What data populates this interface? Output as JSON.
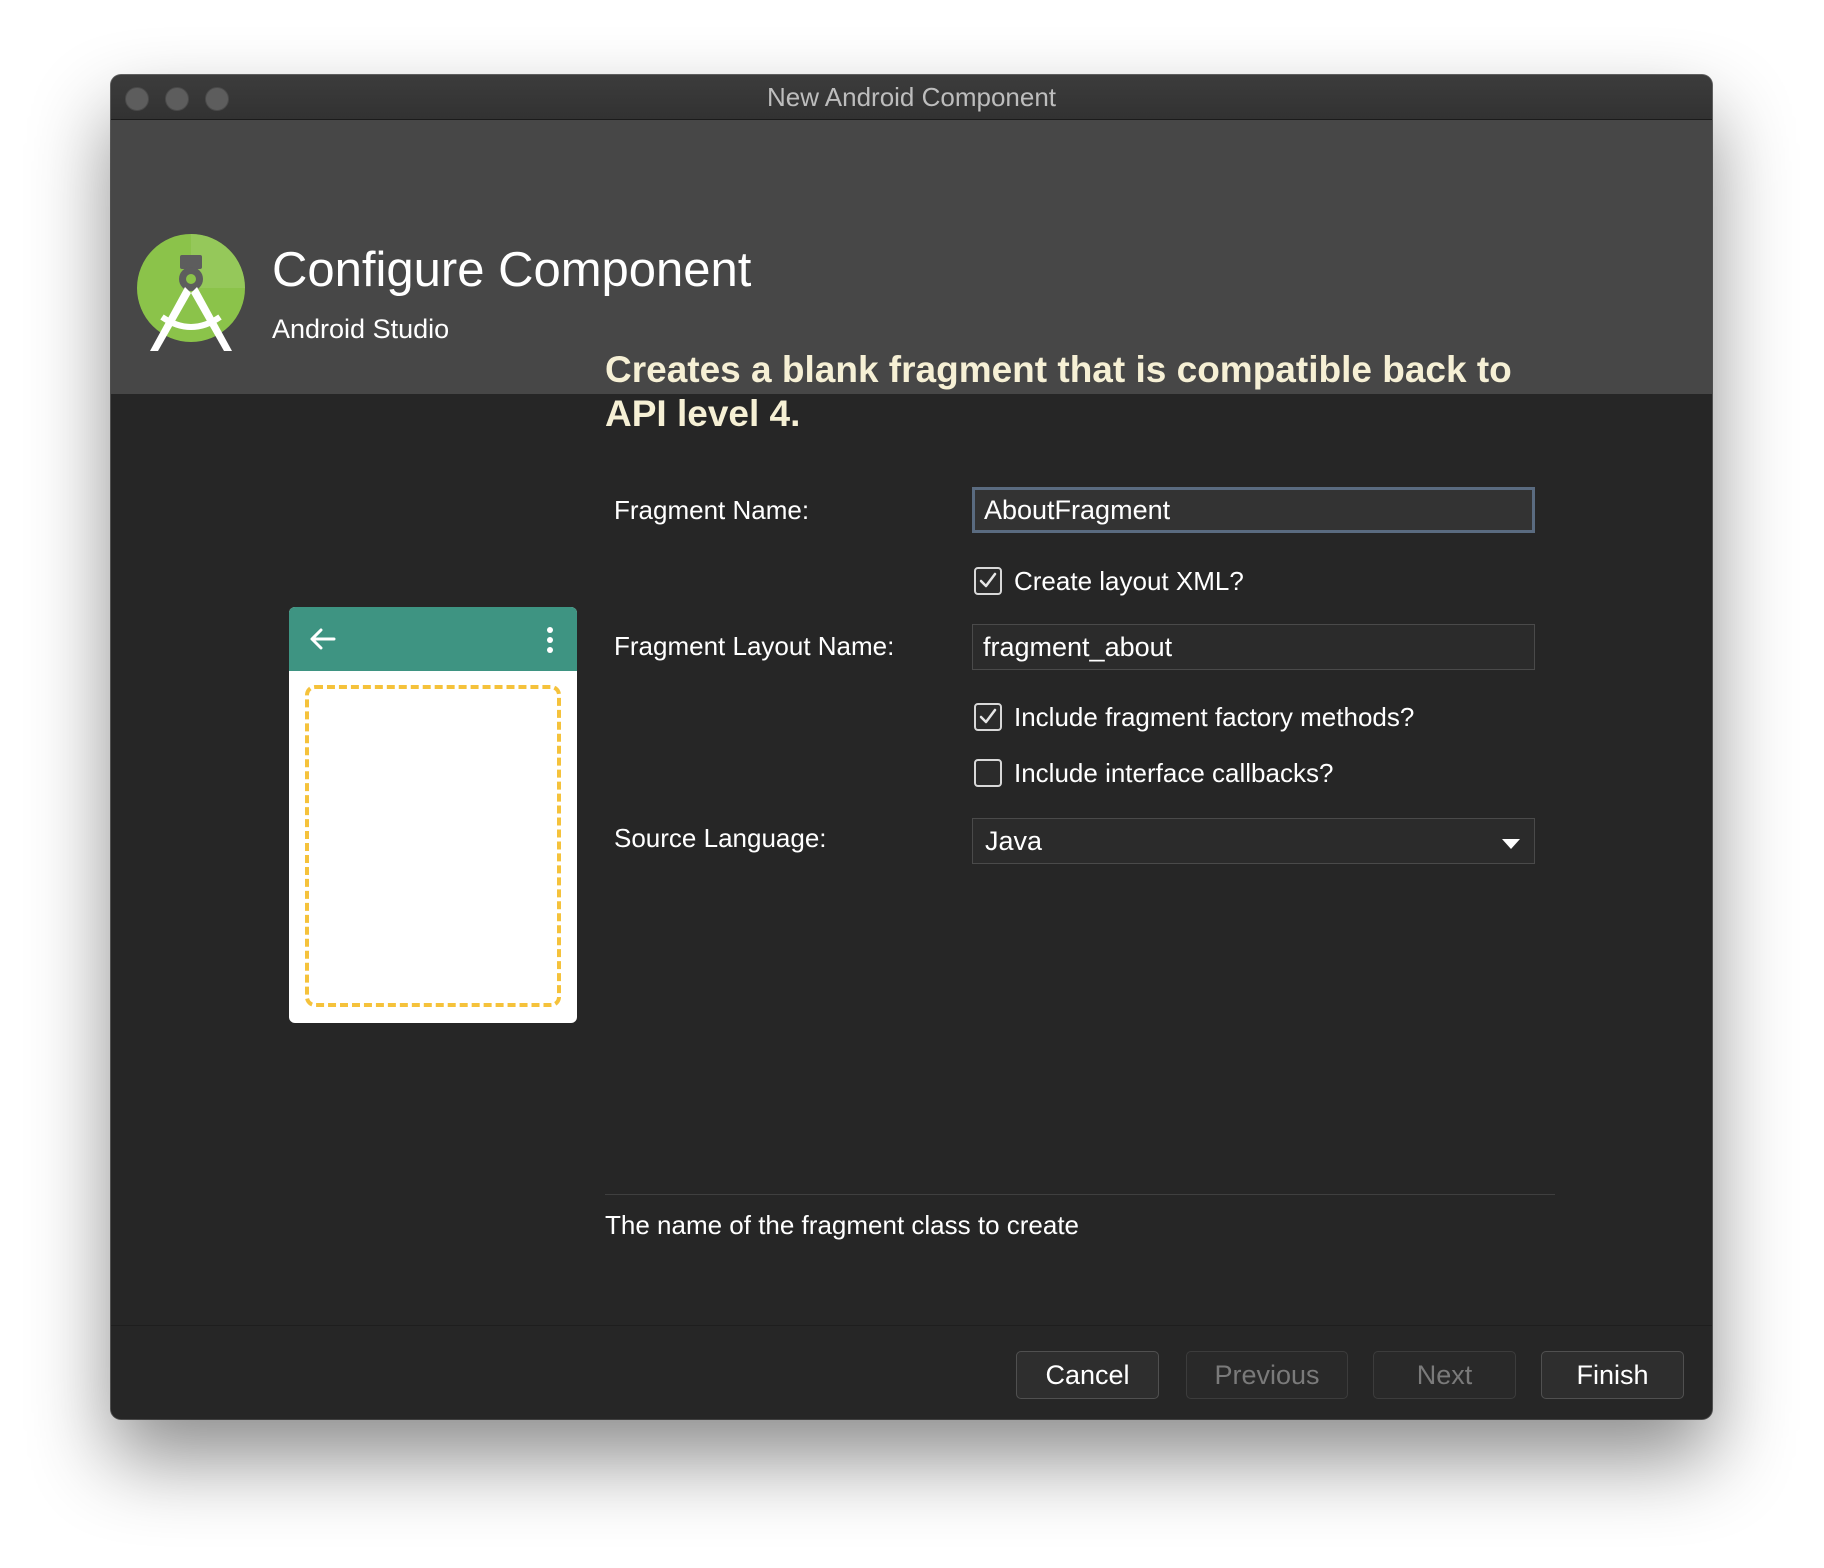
{
  "window": {
    "title": "New Android Component"
  },
  "header": {
    "title": "Configure Component",
    "subtitle": "Android Studio"
  },
  "description": "Creates a blank fragment that is compatible back to API level 4.",
  "form": {
    "fragment_name_label": "Fragment Name:",
    "fragment_name_value": "AboutFragment",
    "create_layout_xml": {
      "label": "Create layout XML?",
      "checked": true
    },
    "fragment_layout_name_label": "Fragment Layout Name:",
    "fragment_layout_name_value": "fragment_about",
    "include_factory_methods": {
      "label": "Include fragment factory methods?",
      "checked": true
    },
    "include_interface_callbacks": {
      "label": "Include interface callbacks?",
      "checked": false
    },
    "source_language_label": "Source Language:",
    "source_language_value": "Java"
  },
  "help_text": "The name of the fragment class to create",
  "buttons": {
    "cancel": "Cancel",
    "previous": "Previous",
    "next": "Next",
    "finish": "Finish"
  },
  "colors": {
    "accent_toolbar": "#3e9482",
    "placeholder_dash": "#f5c23b",
    "headline": "#f6f0d5",
    "logo_green": "#8bc34a"
  },
  "icons": {
    "logo": "android-studio-logo-icon",
    "back": "arrow-left-icon",
    "overflow": "more-vertical-icon",
    "dropdown": "caret-down-icon",
    "check": "check-icon"
  }
}
